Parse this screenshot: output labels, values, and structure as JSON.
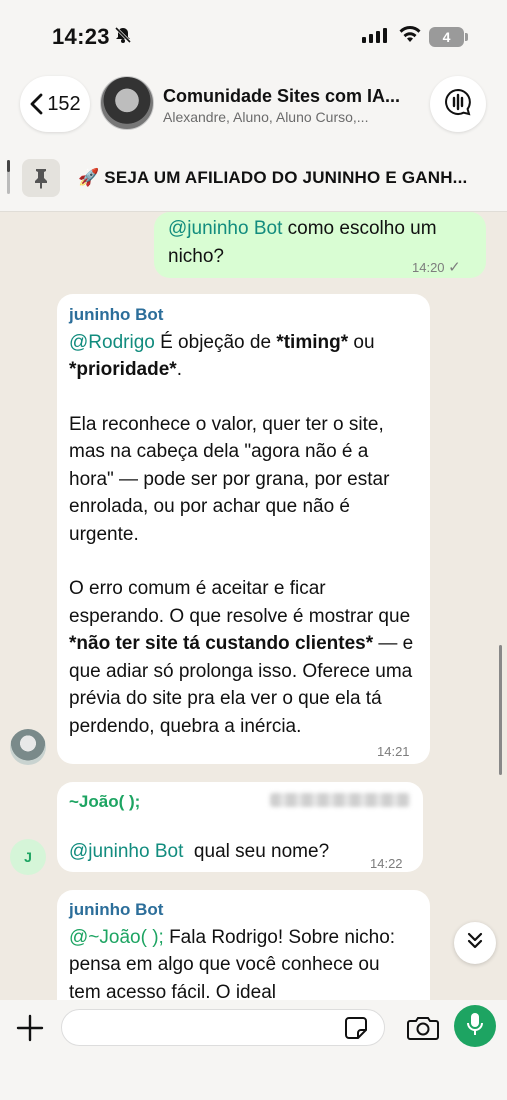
{
  "status_bar": {
    "time": "14:23",
    "battery": "4"
  },
  "header": {
    "back_count": "152",
    "title": "Comunidade Sites com IA...",
    "subtitle": "Alexandre, Aluno, Aluno Curso,..."
  },
  "pinned": {
    "text": "🚀 SEJA UM AFILIADO DO JUNINHO E GANH..."
  },
  "messages": {
    "m1": {
      "mention": "@juninho Bot",
      "text": " como escolho um nicho?",
      "time": "14:20",
      "status": "✓"
    },
    "m2": {
      "sender": "juninho Bot",
      "mention": "@Rodrigo",
      "p1a": " É objeção de ",
      "p1b": "*timing*",
      "p1c": " ou ",
      "p1d": "*prioridade*",
      "p1e": ".",
      "p2": "Ela reconhece o valor, quer ter o site, mas na cabeça dela \"agora não é a hora\" — pode ser por grana, por estar enrolada, ou por achar que não é urgente.",
      "p3a": "O erro comum é aceitar e ficar esperando. O que resolve é mostrar que ",
      "p3b": "*não ter site tá custando clientes*",
      "p3c": " — e que adiar só prolonga isso. Oferece uma prévia do site pra ela ver o que ela tá perdendo, quebra a inércia.",
      "time": "14:21"
    },
    "m3": {
      "sender": "~João( );",
      "mention": "@juninho Bot",
      "text": "  qual seu nome?",
      "time": "14:22",
      "avatar_letter": "J"
    },
    "m4": {
      "sender": "juninho Bot",
      "mention": "@~João( );",
      "text": " Fala Rodrigo! Sobre nicho: pensa em algo que você conhece ou tem acesso fácil. O ideal"
    }
  },
  "icons": {
    "back": "chevron-left-icon",
    "call": "audio-wave-icon",
    "pin": "pin-icon",
    "plus": "plus-icon",
    "sticker": "sticker-icon",
    "camera": "camera-icon",
    "mic": "mic-icon",
    "scroll": "double-chevron-down-icon"
  },
  "colors": {
    "outgoing_bubble": "#d9fdd3",
    "accent_green": "#1da462",
    "background": "#efeae2"
  }
}
